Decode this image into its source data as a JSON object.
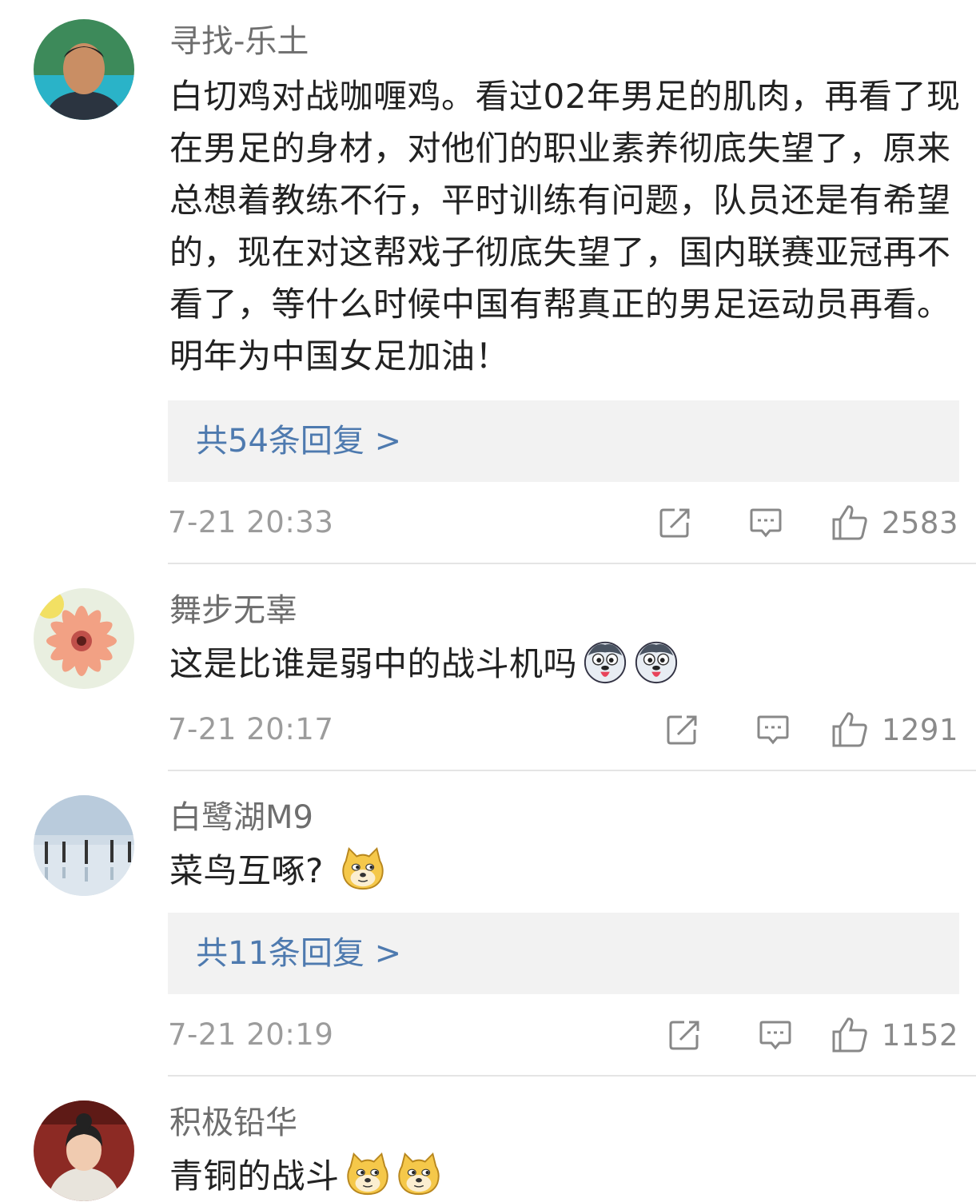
{
  "comments": [
    {
      "username": "寻找-乐土",
      "text": "白切鸡对战咖喱鸡。看过02年男足的肌肉，再看了现在男足的身材，对他们的职业素养彻底失望了，原来总想着教练不行，平时训练有问题，队员还是有希望的，现在对这帮戏子彻底失望了，国内联赛亚冠再不看了，等什么时候中国有帮真正的男足运动员再看。明年为中国女足加油！",
      "replies_label": "共54条回复 >",
      "timestamp": "7-21 20:33",
      "likes": "2583"
    },
    {
      "username": "舞步无辜",
      "text": "这是比谁是弱中的战斗机吗",
      "emojis": [
        "husky-emoji",
        "husky-emoji"
      ],
      "timestamp": "7-21 20:17",
      "likes": "1291"
    },
    {
      "username": "白鹭湖M9",
      "text": "菜鸟互啄? ",
      "emojis": [
        "doge-emoji"
      ],
      "replies_label": "共11条回复 >",
      "timestamp": "7-21 20:19",
      "likes": "1152"
    },
    {
      "username": "积极铅华",
      "text": "青铜的战斗",
      "emojis": [
        "doge-emoji",
        "doge-emoji"
      ]
    }
  ],
  "icons": {
    "repost": "share-icon",
    "comment": "comment-icon",
    "like": "thumbs-up-icon"
  },
  "colors": {
    "link": "#4e7aaf",
    "username": "#6e6e6e",
    "text": "#222222",
    "meta": "#9c9c9c",
    "reply_bg": "#f2f2f2"
  }
}
